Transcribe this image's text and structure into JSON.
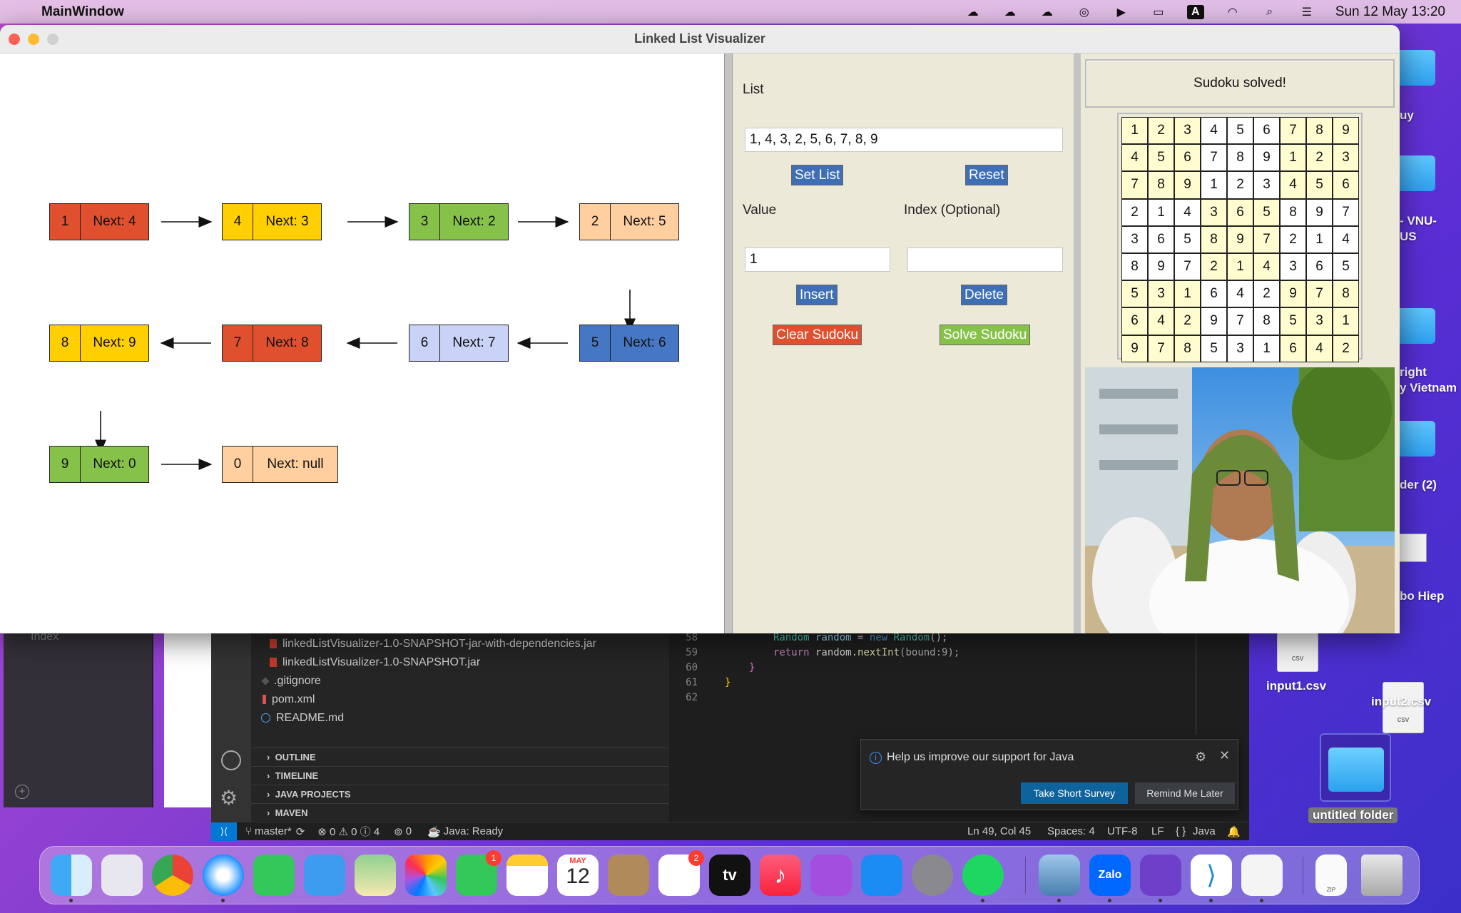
{
  "menubar": {
    "app_name": "MainWindow",
    "clock": "Sun 12 May  13:20"
  },
  "window": {
    "title": "Linked List Visualizer"
  },
  "linked_list": {
    "nodes": [
      {
        "value": "1",
        "next": "Next: 4",
        "color": "#e0502f"
      },
      {
        "value": "4",
        "next": "Next: 3",
        "color": "#ffcf00"
      },
      {
        "value": "3",
        "next": "Next: 2",
        "color": "#86c24a"
      },
      {
        "value": "2",
        "next": "Next: 5",
        "color": "#ffcfa0"
      },
      {
        "value": "5",
        "next": "Next: 6",
        "color": "#4677c4"
      },
      {
        "value": "6",
        "next": "Next: 7",
        "color": "#c8d3f7"
      },
      {
        "value": "7",
        "next": "Next: 8",
        "color": "#e0502f"
      },
      {
        "value": "8",
        "next": "Next: 9",
        "color": "#ffcf00"
      },
      {
        "value": "9",
        "next": "Next: 0",
        "color": "#86c24a"
      },
      {
        "value": "0",
        "next": "Next: null",
        "color": "#ffcfa0"
      }
    ]
  },
  "controls": {
    "list_label": "List",
    "list_value": "1, 4, 3, 2, 5, 6, 7, 8, 9",
    "set_list": "Set List",
    "reset": "Reset",
    "value_label": "Value",
    "value_value": "1",
    "index_label": "Index (Optional)",
    "index_value": "",
    "insert": "Insert",
    "delete": "Delete",
    "clear_sudoku": "Clear Sudoku",
    "solve_sudoku": "Solve Sudoku",
    "btn_blue": "#3e6fb5",
    "btn_red": "#e0502f",
    "btn_green": "#86c24a"
  },
  "sudoku": {
    "status": "Sudoku solved!",
    "grid": [
      [
        1,
        2,
        3,
        4,
        5,
        6,
        7,
        8,
        9
      ],
      [
        4,
        5,
        6,
        7,
        8,
        9,
        1,
        2,
        3
      ],
      [
        7,
        8,
        9,
        1,
        2,
        3,
        4,
        5,
        6
      ],
      [
        2,
        1,
        4,
        3,
        6,
        5,
        8,
        9,
        7
      ],
      [
        3,
        6,
        5,
        8,
        9,
        7,
        2,
        1,
        4
      ],
      [
        8,
        9,
        7,
        2,
        1,
        4,
        3,
        6,
        5
      ],
      [
        5,
        3,
        1,
        6,
        4,
        2,
        9,
        7,
        8
      ],
      [
        6,
        4,
        2,
        9,
        7,
        8,
        5,
        3,
        1
      ],
      [
        9,
        7,
        8,
        5,
        3,
        1,
        6,
        4,
        2
      ]
    ],
    "color_light": "#fffdd0",
    "color_white": "#ffffff"
  },
  "vscode": {
    "files": [
      "linkedListVisualizer-1.0-SNAPSHOT-jar-with-dependencies.jar",
      "linkedListVisualizer-1.0-SNAPSHOT.jar",
      ".gitignore",
      "pom.xml",
      "README.md"
    ],
    "sections": [
      "OUTLINE",
      "TIMELINE",
      "JAVA PROJECTS",
      "MAVEN"
    ],
    "line_numbers": [
      "58",
      "59",
      "60",
      "61",
      "62"
    ],
    "code": {
      "l58_type": "Random",
      "l58_var": "random",
      "l58_eq": " = ",
      "l58_new": "new",
      "l58_ctor": " Random",
      "l58_end": "();",
      "l59_ret": "return",
      "l59_rest": " random.",
      "l59_call": "nextInt",
      "l59_args": "(bound:9);",
      "l60": "}",
      "l61": "}"
    },
    "notification": {
      "message": "Help us improve our support for Java",
      "primary": "Take Short Survey",
      "secondary": "Remind Me Later"
    },
    "status": {
      "branch": "master*",
      "problems": "⊗ 0 ⚠ 0 ⓘ 4",
      "ports": "0",
      "java": "Java: Ready",
      "position": "Ln 49, Col 45",
      "spaces": "Spaces: 4",
      "encoding": "UTF-8",
      "eol": "LF",
      "language": "Java"
    }
  },
  "background_app": {
    "index_label": "Index"
  },
  "desktop": {
    "labels": [
      "uy",
      "- VNU-",
      "US",
      "right",
      "y Vietnam",
      "der (2)",
      "bo Hiep"
    ],
    "files": [
      {
        "name": "input1.csv",
        "type": "csv"
      },
      {
        "name": "input2.csv",
        "type": "csv"
      }
    ],
    "folder": "untitled folder",
    "zip_label": "ZIP"
  },
  "dock": {
    "badges": {
      "facetime": "1",
      "reminders": "2"
    },
    "calendar_month": "MAY",
    "calendar_day": "12",
    "tv_label": "tv",
    "zalo_label": "Zalo"
  }
}
